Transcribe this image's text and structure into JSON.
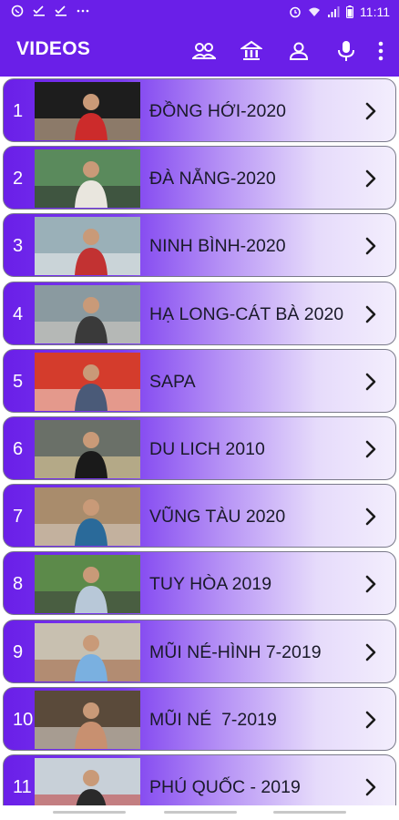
{
  "status_bar": {
    "time": "11:11",
    "left_icons": [
      "viber-icon",
      "check-icon",
      "check-icon",
      "overflow-dots-icon"
    ],
    "right_icons": [
      "alarm-icon",
      "wifi-icon",
      "signal-icon",
      "battery-icon"
    ]
  },
  "app_bar": {
    "title": "VIDEOS",
    "actions": [
      "group-icon",
      "building-icon",
      "person-icon",
      "mic-icon",
      "more-vert-icon"
    ]
  },
  "colors": {
    "primary": "#6a1fe8",
    "row_gradient_end": "#f3eefd",
    "text_dark": "#1a1a2a"
  },
  "videos": [
    {
      "number": "1",
      "title": "ĐỒNG HỚI-2020"
    },
    {
      "number": "2",
      "title": "ĐÀ NẴNG-2020"
    },
    {
      "number": "3",
      "title": "NINH BÌNH-2020"
    },
    {
      "number": "4",
      "title": "HẠ LONG-CÁT BÀ 2020"
    },
    {
      "number": "5",
      "title": "SAPA"
    },
    {
      "number": "6",
      "title": "DU LICH 2010"
    },
    {
      "number": "7",
      "title": "VŨNG TÀU 2020"
    },
    {
      "number": "8",
      "title": "TUY HÒA 2019"
    },
    {
      "number": "9",
      "title": "MŨI NÉ-HÌNH 7-2019"
    },
    {
      "number": "10",
      "title": "MŨI NÉ  7-2019"
    },
    {
      "number": "11",
      "title": "PHÚ QUỐC - 2019"
    }
  ]
}
